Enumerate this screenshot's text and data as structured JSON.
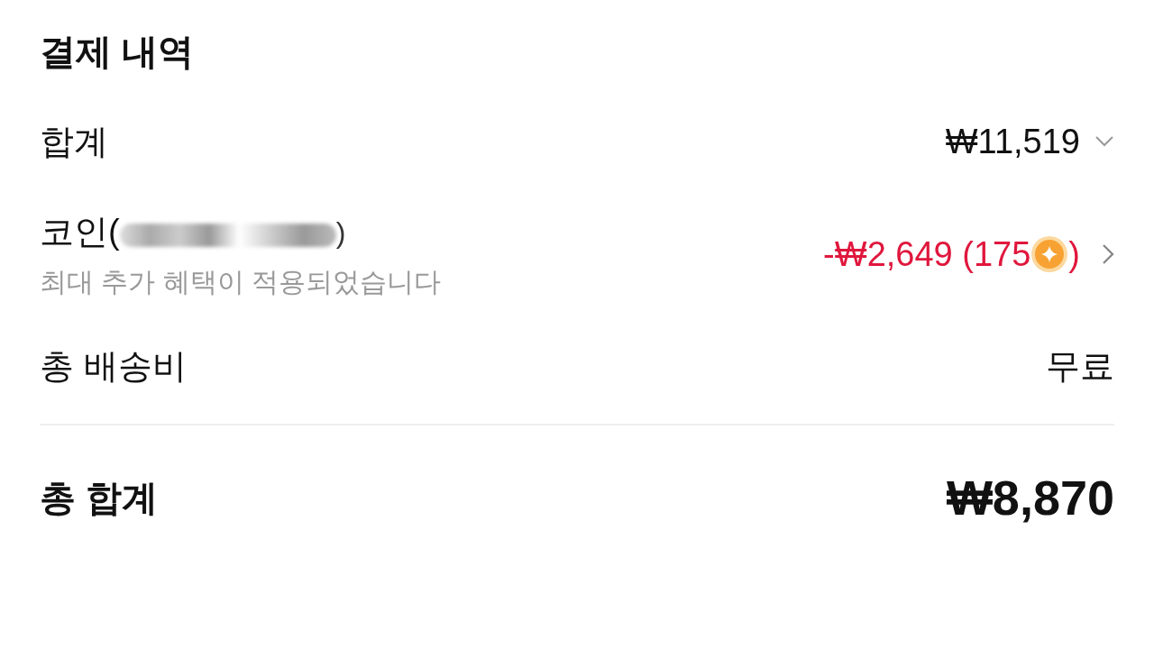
{
  "title": "결제 내역",
  "rows": [
    {
      "kind": "expand",
      "label": "합계",
      "value": "₩11,519"
    },
    {
      "kind": "coin",
      "label": "코인(",
      "label_end": ")",
      "note": "최대 추가 혜택이 적용되었습니다",
      "value": "-₩2,649 (175",
      "value_end": ")"
    },
    {
      "kind": "plain",
      "label": "총 배송비",
      "value": "무료"
    },
    {
      "kind": "total",
      "label": "총 합계",
      "value": "₩8,870"
    }
  ]
}
